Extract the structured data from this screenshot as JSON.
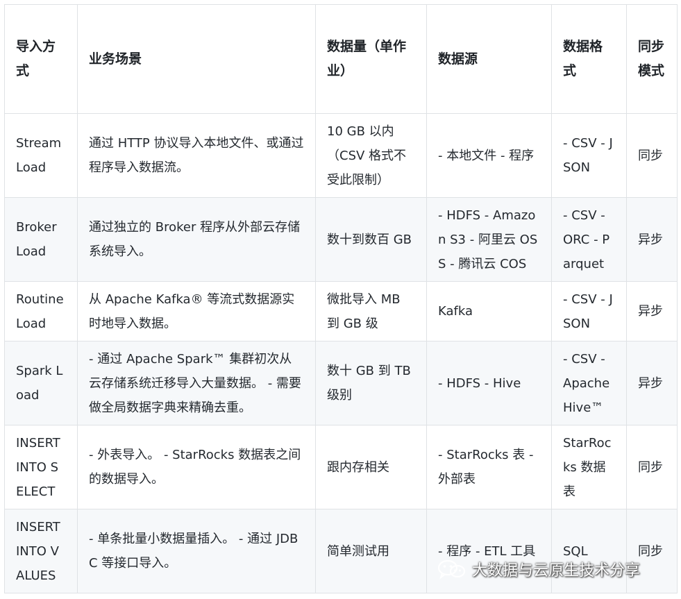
{
  "table": {
    "headers": [
      "导入方式",
      "业务场景",
      "数据量（单作业）",
      "数据源",
      "数据格式",
      "同步模式"
    ],
    "rows": [
      [
        "Stream Load",
        "通过 HTTP 协议导入本地文件、或通过程序导入数据流。",
        "10 GB 以内（CSV 格式不受此限制）",
        "- 本地文件 - 程序",
        "- CSV - JSON",
        "同步"
      ],
      [
        "Broker Load",
        "通过独立的 Broker 程序从外部云存储系统导入。",
        "数十到数百 GB",
        "- HDFS - Amazon S3 - 阿里云 OSS - 腾讯云 COS",
        "- CSV - ORC - Parquet",
        "异步"
      ],
      [
        "Routine Load",
        "从 Apache Kafka® 等流式数据源实时地导入数据。",
        "微批导入 MB 到 GB 级",
        "Kafka",
        "- CSV - JSON",
        "异步"
      ],
      [
        "Spark Load",
        "- 通过 Apache Spark™ 集群初次从云存储系统迁移导入大量数据。 - 需要做全局数据字典来精确去重。",
        "数十 GB 到 TB 级别",
        "- HDFS - Hive",
        "- CSV - Apache Hive™",
        "异步"
      ],
      [
        "INSERT INTO SELECT",
        "- 外表导入。 - StarRocks 数据表之间的数据导入。",
        "跟内存相关",
        "- StarRocks 表 - 外部表",
        "StarRocks 数据表",
        "同步"
      ],
      [
        "INSERT INTO VALUES",
        "- 单条批量小数据量插入。 - 通过 JDBC 等接口导入。",
        "简单测试用",
        "- 程序 - ETL 工具",
        "SQL",
        "同步"
      ]
    ]
  },
  "watermark": {
    "icon": "wechat-icon",
    "text": "大数据与云原生技术分享"
  }
}
